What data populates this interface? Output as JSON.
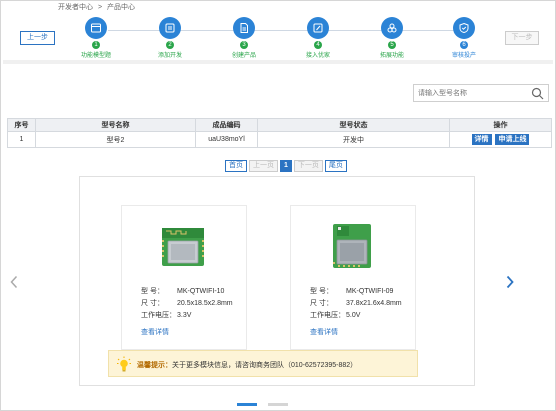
{
  "breadcrumb": [
    "开发者中心",
    ">",
    "产品中心"
  ],
  "nav": {
    "prev_label": "上一步",
    "next_label": "下一步"
  },
  "steps": [
    {
      "num": "1",
      "label": "功能模型题"
    },
    {
      "num": "2",
      "label": "添加开发"
    },
    {
      "num": "3",
      "label": "创建产品"
    },
    {
      "num": "4",
      "label": "接入优家"
    },
    {
      "num": "5",
      "label": "拓展功能"
    },
    {
      "num": "6",
      "label": "审核投产"
    }
  ],
  "search": {
    "placeholder": "请输入型号名称"
  },
  "table": {
    "headers": [
      "序号",
      "型号名称",
      "成品编码",
      "型号状态",
      "操作"
    ],
    "rows": [
      {
        "index": "1",
        "model": "型号2",
        "code": "uaU38moYl",
        "status": "开发中",
        "actions": [
          "详情",
          "申请上线"
        ]
      }
    ]
  },
  "pager": {
    "first": "首页",
    "prev": "上一页",
    "current": "1",
    "next": "下一页",
    "last": "尾页"
  },
  "cards": [
    {
      "model_label": "型    号：",
      "model": "MK-QTWIFI-10",
      "size_label": "尺    寸：",
      "size": "20.5x18.5x2.8mm",
      "voltage_label": "工作电压：",
      "voltage": "3.3V",
      "more": "查看详情"
    },
    {
      "model_label": "型    号：",
      "model": "MK-QTWIFI-09",
      "size_label": "尺    寸：",
      "size": "37.8x21.6x4.8mm",
      "voltage_label": "工作电压：",
      "voltage": "5.0V",
      "more": "查看详情"
    }
  ],
  "tip": {
    "title": "温馨提示：",
    "text": "关于更多模块信息，请咨询商务团队（010-62572395-882）"
  },
  "colors": {
    "primary": "#2b73c2",
    "step_blue": "#2b83d6",
    "done_green": "#2aa54a",
    "tip_bg": "#fdf4d7"
  },
  "icons": [
    "arrow-left-icon",
    "arrow-right-icon",
    "search-icon",
    "lightbulb-icon"
  ]
}
